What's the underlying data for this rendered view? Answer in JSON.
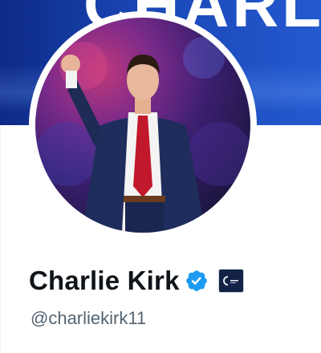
{
  "banner": {
    "text": "CHARLI"
  },
  "profile": {
    "display_name": "Charlie Kirk",
    "handle": "@charliekirk11",
    "verified": true,
    "verified_icon": "verified-badge-icon",
    "affiliate_icon": "affiliate-org-badge-icon"
  },
  "colors": {
    "banner": "#1a47b6",
    "verified": "#1d9bf0",
    "name": "#0f1419",
    "handle": "#536471",
    "affiliate": "#142245"
  }
}
